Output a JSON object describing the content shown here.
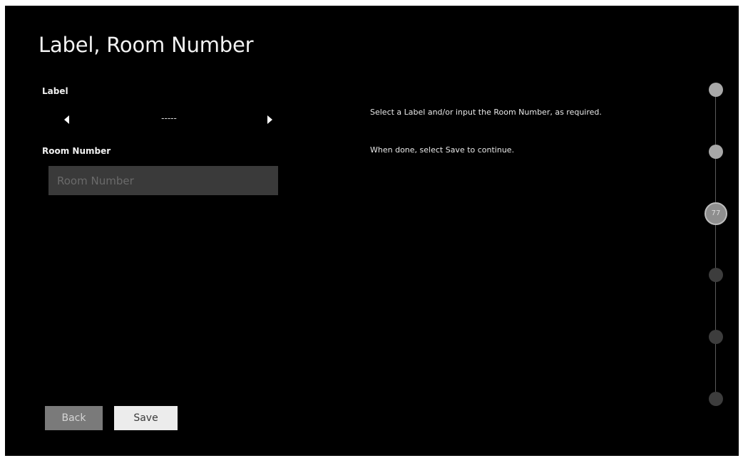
{
  "page": {
    "title": "Label, Room Number"
  },
  "form": {
    "label_caption": "Label",
    "label_value": "-----",
    "room_caption": "Room Number",
    "room_placeholder": "Room Number",
    "room_value": ""
  },
  "help": {
    "line1": "Select a Label and/or input the Room Number, as required.",
    "line2": "When done, select Save to continue."
  },
  "stepper": {
    "current_label": "77",
    "steps": [
      "done",
      "done",
      "current",
      "todo",
      "todo",
      "todo"
    ]
  },
  "buttons": {
    "back_label": "Back",
    "save_label": "Save"
  },
  "colors": {
    "background": "#000000",
    "input_bg": "#3a3a3a",
    "back_button": "#7a7a7a",
    "save_button": "#ececec"
  }
}
